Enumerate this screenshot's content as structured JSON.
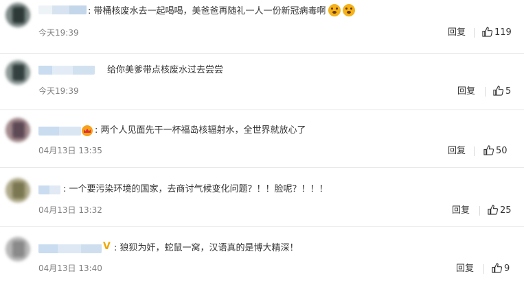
{
  "comments": [
    {
      "text": "带桶核废水去一起喝喝，美爸爸再随礼一人一份新冠病毒啊",
      "emojis": [
        "scared-face-emoji",
        "scared-face-emoji"
      ],
      "time": "今天19:39",
      "reply_label": "回复",
      "likes": "119"
    },
    {
      "text": "给你美爹带点核废水过去尝尝",
      "time": "今天19:39",
      "reply_label": "回复",
      "likes": "5"
    },
    {
      "text": "两个人见面先干一杯福岛核辐射水，全世界就放心了",
      "badge": "crown-icon",
      "time": "04月13日 13:35",
      "reply_label": "回复",
      "likes": "50"
    },
    {
      "text": "一个要污染环境的国家，去商讨气候变化问题？！！脸呢？！！！",
      "time": "04月13日 13:32",
      "reply_label": "回复",
      "likes": "25"
    },
    {
      "text": "狼狈为奸，蛇鼠一窝，汉语真的是博大精深！",
      "badge": "V",
      "time": "04月13日 13:40",
      "reply_label": "回复",
      "likes": "9"
    }
  ],
  "colors": {
    "text": "#333333",
    "time": "#808080",
    "separator": "#e6e6e6",
    "username_blur": "#c9dcf0"
  },
  "icons": {
    "like": "thumbs-up-icon"
  }
}
